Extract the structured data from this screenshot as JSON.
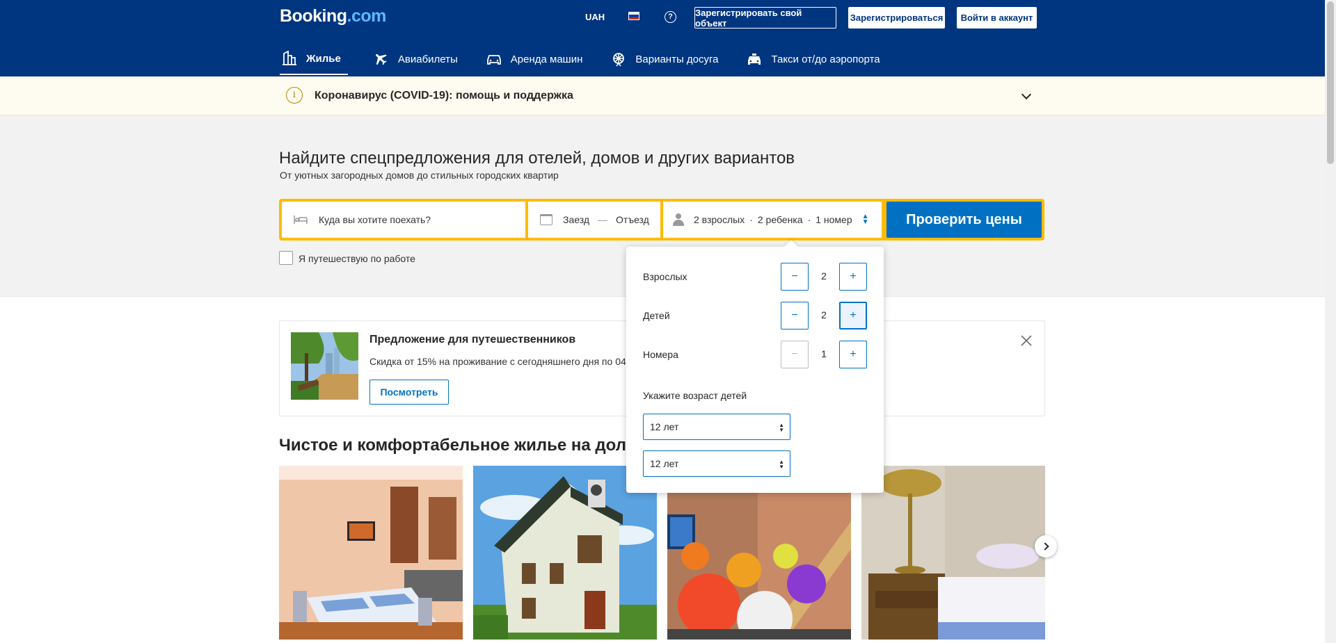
{
  "header": {
    "logo_text": "Booking",
    "logo_domain": ".com",
    "currency": "UAH",
    "language_flag": "flag-ru-icon",
    "help_icon": "help-icon",
    "help_glyph": "?",
    "list_property": "Зарегистрировать свой объект",
    "register": "Зарегистрироваться",
    "sign_in": "Войти в аккаунт"
  },
  "nav": {
    "items": [
      {
        "label": "Жилье",
        "icon": "bed-icon",
        "active": true
      },
      {
        "label": "Авиабилеты",
        "icon": "plane-icon"
      },
      {
        "label": "Аренда машин",
        "icon": "car-icon"
      },
      {
        "label": "Варианты досуга",
        "icon": "attractions-icon"
      },
      {
        "label": "Такси от/до аэропорта",
        "icon": "taxi-icon"
      }
    ]
  },
  "covid": {
    "text": "Коронавирус (COVID-19): помощь и поддержка",
    "icon_glyph": "i"
  },
  "hero": {
    "title": "Найдите спецпредложения для отелей, домов и других вариантов",
    "subtitle": "От уютных загородных домов до стильных городских квартир"
  },
  "search": {
    "destination_placeholder": "Куда вы хотите поехать?",
    "checkin": "Заезд",
    "dash": "—",
    "checkout": "Отъезд",
    "adults": "2 взрослых",
    "children": "2 ребенка",
    "rooms": "1 номер",
    "separator": "·",
    "submit": "Проверить цены",
    "work_travel": "Я путешествую по работе"
  },
  "occupancy": {
    "rows": [
      {
        "label": "Взрослых",
        "value": "2",
        "minus": "−",
        "plus": "+"
      },
      {
        "label": "Детей",
        "value": "2",
        "minus": "−",
        "plus": "+"
      },
      {
        "label": "Номера",
        "value": "1",
        "minus": "−",
        "plus": "+"
      }
    ],
    "age_title": "Укажите возраст детей",
    "child_ages": [
      "12 лет",
      "12 лет"
    ]
  },
  "promo": {
    "title": "Предложение для путешественников",
    "text": "Скидка от 15% на проживание с сегодняшнего дня по 04.",
    "button": "Посмотреть"
  },
  "section": {
    "title": "Чистое и комфортабельное жилье на дол"
  },
  "colors": {
    "brand_dark": "#003580",
    "accent_yellow": "#febb02",
    "primary_blue": "#0071c2",
    "covid_bg": "#fefbf0"
  }
}
